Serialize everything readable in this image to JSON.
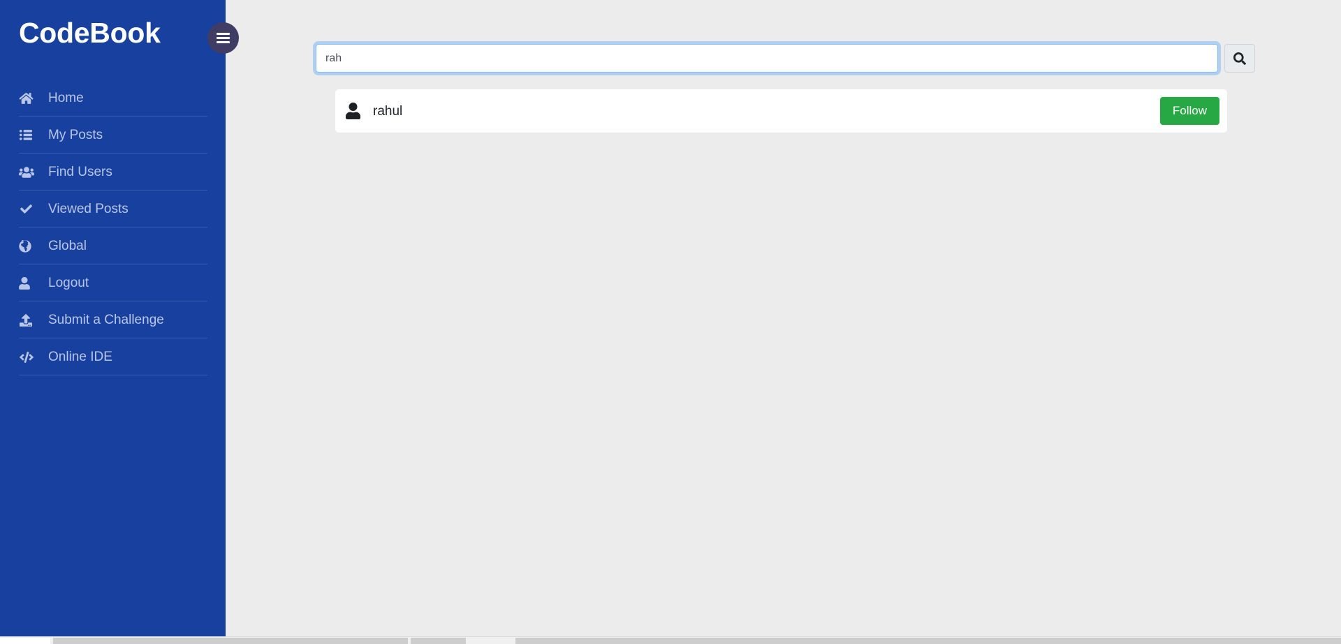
{
  "app": {
    "brand": "CodeBook",
    "background_color": "#ececec",
    "sidebar_color": "#17409f",
    "accent_color": "#28a745"
  },
  "sidebar": {
    "toggle": {
      "name": "sidebar-toggle",
      "icon": "hamburger-icon",
      "color": "#3f3d63"
    },
    "items": [
      {
        "label": "Home",
        "icon": "home-icon"
      },
      {
        "label": "My Posts",
        "icon": "list-icon"
      },
      {
        "label": "Find Users",
        "icon": "users-icon"
      },
      {
        "label": "Viewed Posts",
        "icon": "check-icon"
      },
      {
        "label": "Global",
        "icon": "globe-icon"
      },
      {
        "label": "Logout",
        "icon": "user-icon"
      },
      {
        "label": "Submit a Challenge",
        "icon": "upload-icon"
      },
      {
        "label": "Online IDE",
        "icon": "code-icon"
      }
    ]
  },
  "search": {
    "value": "rah",
    "placeholder": "",
    "button_icon": "search-icon"
  },
  "results": [
    {
      "username": "rahul",
      "avatar_icon": "user-avatar-icon",
      "action_label": "Follow"
    }
  ]
}
